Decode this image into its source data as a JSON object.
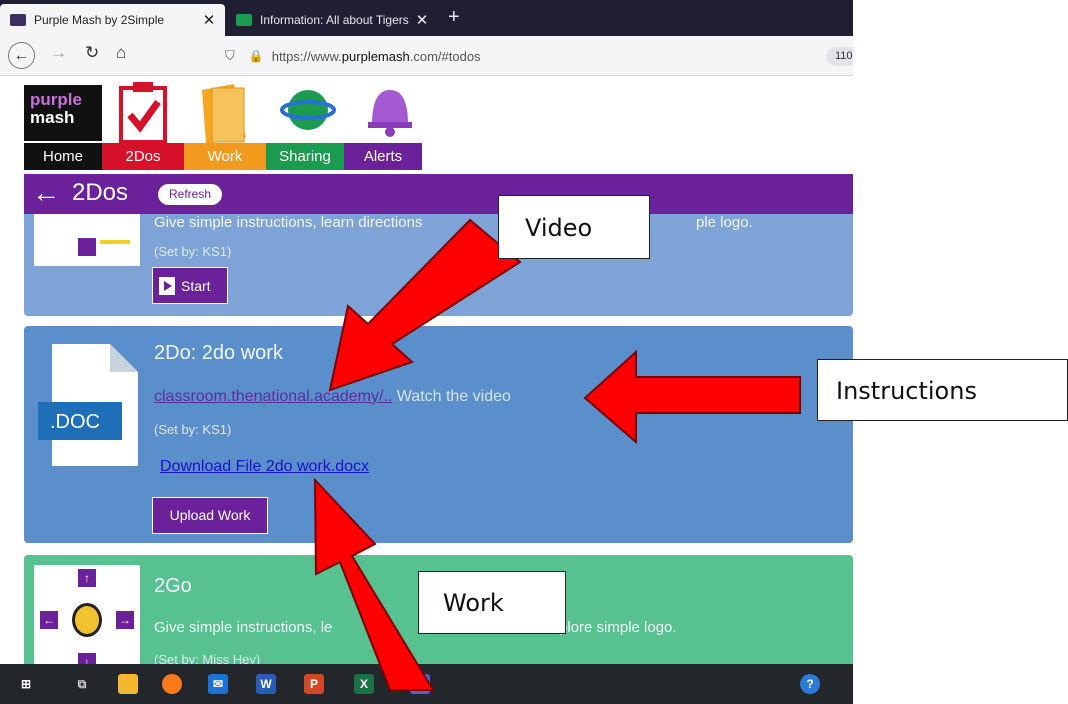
{
  "browser": {
    "tabs": [
      {
        "title": "Purple Mash by 2Simple",
        "active": true
      },
      {
        "title": "Information: All about Tigers - ",
        "active": false
      }
    ],
    "url_prefix": "https://www.",
    "url_domain": "purplemash",
    "url_suffix": ".com/#todos",
    "zoom": "110"
  },
  "purplemash": {
    "logo_line1": "purple",
    "logo_line2": "mash",
    "nav": [
      {
        "label": "Home",
        "color": "#111111"
      },
      {
        "label": "2Dos",
        "color": "#d8112b"
      },
      {
        "label": "Work",
        "color": "#f29a1d"
      },
      {
        "label": "Sharing",
        "color": "#1a9b4f"
      },
      {
        "label": "Alerts",
        "color": "#6a2199"
      }
    ],
    "page_title": "2Dos",
    "refresh_label": "Refresh"
  },
  "cards": {
    "first": {
      "description": "Give simple instructions, learn directions",
      "description_tail": "ple logo.",
      "set_by": "(Set by: KS1)",
      "start_label": "Start"
    },
    "second": {
      "title": "2Do: 2do work",
      "link_text": "classroom.thenational.academy/..",
      "instruction": " Watch the video",
      "set_by": "(Set by: KS1)",
      "download_label": "Download File 2do work.docx",
      "upload_label": "Upload Work",
      "doc_ext": ".DOC"
    },
    "third": {
      "title": "2Go",
      "description_start": "Give simple instructions, le",
      "description_end": "plore simple logo.",
      "set_by": "(Set by: Miss Hey)"
    }
  },
  "annotations": {
    "video_label": "Video",
    "instructions_label": "Instructions",
    "work_label": "Work"
  }
}
